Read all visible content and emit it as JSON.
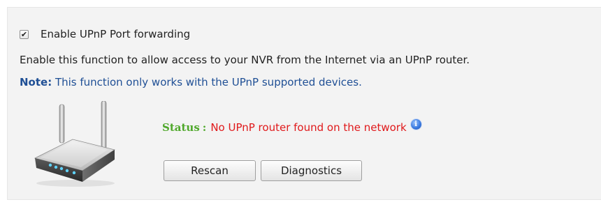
{
  "upnp": {
    "checkbox_checked": true,
    "checkbox_mark": "✔",
    "checkbox_label": "Enable UPnP Port forwarding",
    "description": "Enable this function to allow access to your NVR from the Internet via an UPnP router.",
    "note_label": "Note:",
    "note_text": " This function only works with the UPnP supported devices.",
    "router_icon": "wireless-router-icon",
    "status_label": "Status",
    "status_colon": ":",
    "status_value": "No UPnP router found on the network",
    "info_icon": "info-icon",
    "info_glyph": "i",
    "buttons": {
      "rescan": "Rescan",
      "diagnostics": "Diagnostics"
    }
  },
  "colors": {
    "panel_bg": "#f3f3f3",
    "note_blue": "#1f4f95",
    "status_green": "#4fa82b",
    "status_red": "#e0191b"
  }
}
